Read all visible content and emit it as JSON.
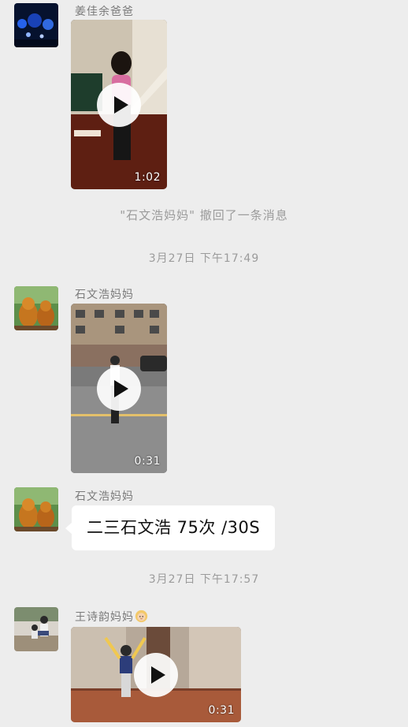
{
  "messages": [
    {
      "sender": "姜佳余爸爸",
      "type": "video",
      "duration": "1:02"
    },
    {
      "type": "system",
      "text": "\"石文浩妈妈\" 撤回了一条消息"
    },
    {
      "type": "time",
      "text": "3月27日 下午17:49"
    },
    {
      "sender": "石文浩妈妈",
      "type": "video",
      "duration": "0:31"
    },
    {
      "sender": "石文浩妈妈",
      "type": "text",
      "text": "二三石文浩 75次 /30S"
    },
    {
      "type": "time",
      "text": "3月27日 下午17:57"
    },
    {
      "sender": "王诗韵妈妈",
      "sender_emoji": "woman-emoji",
      "type": "video",
      "duration": "0:31"
    }
  ],
  "icons": {
    "play": "play-icon",
    "colors": {
      "background": "#ededed",
      "bubble": "#ffffff",
      "meta_text": "#9b9b9b"
    }
  }
}
